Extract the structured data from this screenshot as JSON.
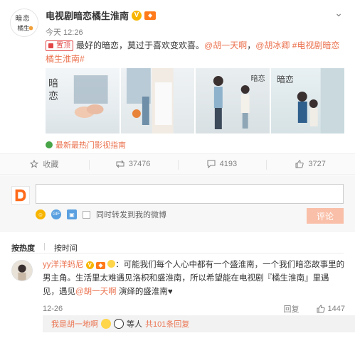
{
  "post": {
    "author": "电视剧暗恋橘生淮南",
    "time": "今天 12:26",
    "pin_label": "置顶",
    "text": "最好的暗恋，莫过于喜欢变欢喜。",
    "mentions": [
      "@胡一天啊",
      "@胡冰卿",
      "#电视剧暗恋橘生淮南#"
    ],
    "source": "最新最热门影视指南"
  },
  "actions": {
    "collect": "收藏",
    "repost_count": "37476",
    "comment_count": "4193",
    "like_count": "3727"
  },
  "compose": {
    "placeholder": "",
    "forward_label": "同时转发到我的微博",
    "submit": "评论"
  },
  "sort": {
    "hot": "按热度",
    "time": "按时间"
  },
  "comment": {
    "user": "yy洋洋蚂尼",
    "text_1": "：可能我们每个人心中都有一个盛淮南，一个我们暗恋故事里的男主角。生活里太难遇见洛枳和盛淮南，所以希望能在电视剧『橘生淮南』里遇见，遇见",
    "mention": "@胡一天啊",
    "text_2": " 演绎的盛淮南♥",
    "time": "12-26",
    "reply_label": "回复",
    "like_count": "1447",
    "reply_user": "我是胡一地啊",
    "reply_others": "等人",
    "reply_count": "共101条回复"
  },
  "colors": {
    "accent": "#eb7350",
    "pin": "#e24545",
    "submit_disabled": "#f9bfa8"
  }
}
